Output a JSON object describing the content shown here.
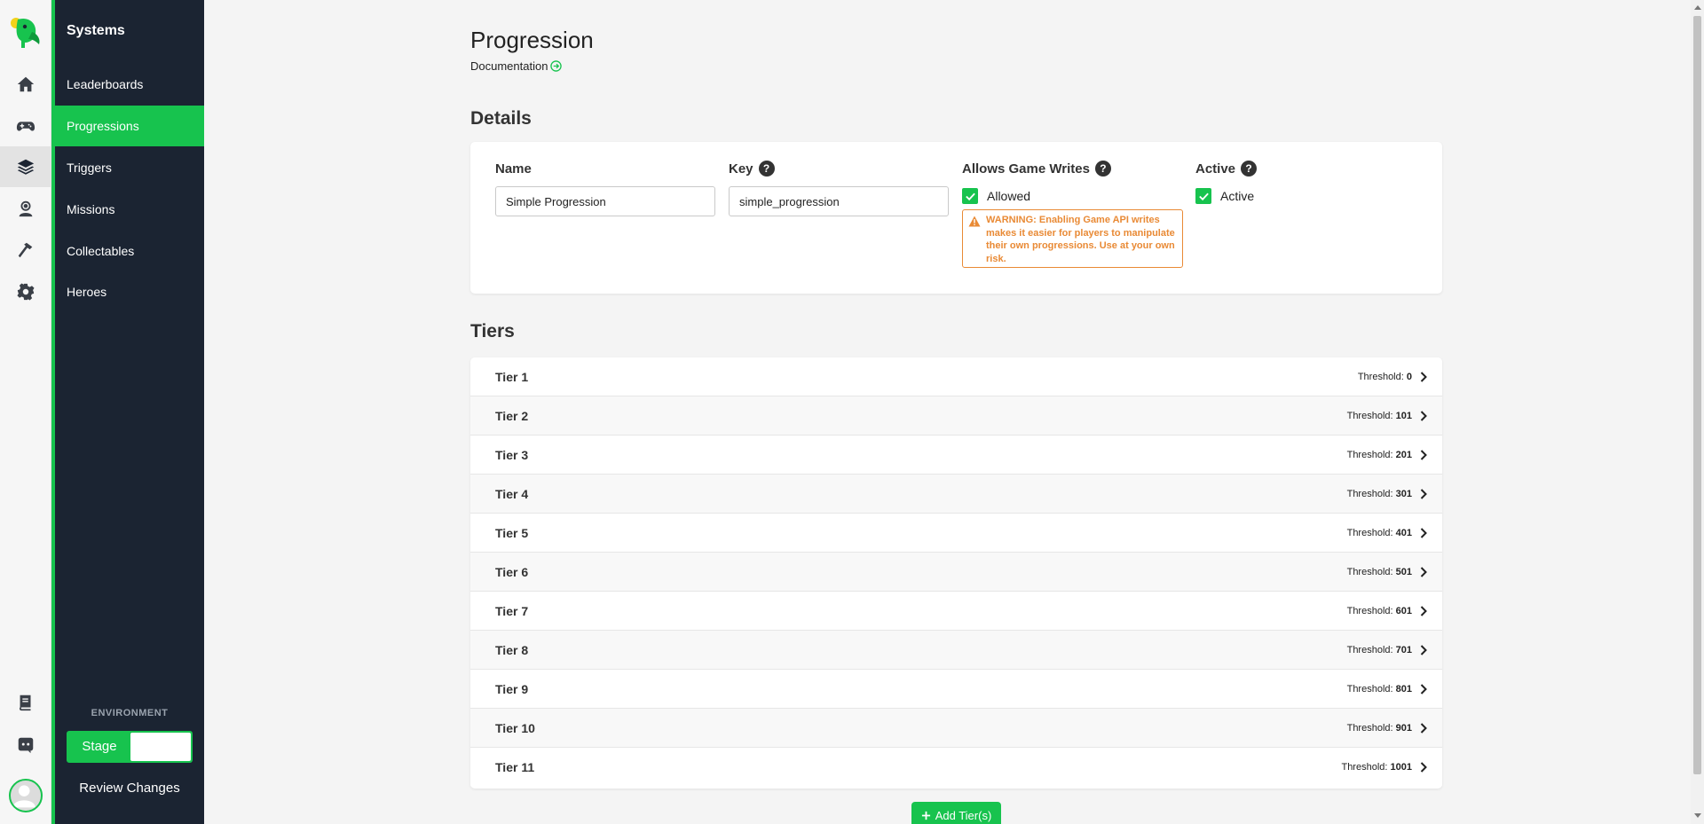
{
  "sidebar": {
    "title": "Systems",
    "items": [
      {
        "label": "Leaderboards"
      },
      {
        "label": "Progressions"
      },
      {
        "label": "Triggers"
      },
      {
        "label": "Missions"
      },
      {
        "label": "Collectables"
      },
      {
        "label": "Heroes"
      }
    ],
    "active_index": 1,
    "environment_label": "ENVIRONMENT",
    "environment_value": "Stage",
    "review_changes": "Review Changes"
  },
  "rail": {
    "icons": [
      "home-icon",
      "gamepad-icon",
      "layers-icon",
      "user-headset-icon",
      "hammer-icon",
      "gear-icon",
      "book-icon",
      "discord-icon"
    ],
    "active_icon": "layers-icon"
  },
  "page": {
    "title": "Progression",
    "doc_link": "Documentation"
  },
  "details": {
    "section_title": "Details",
    "name_label": "Name",
    "name_value": "Simple Progression",
    "key_label": "Key",
    "key_value": "simple_progression",
    "writes_label": "Allows Game Writes",
    "writes_checkbox": "Allowed",
    "warning": "WARNING: Enabling Game API writes makes it easier for players to manipulate their own progressions. Use at your own risk.",
    "active_label": "Active",
    "active_checkbox": "Active"
  },
  "tiers": {
    "section_title": "Tiers",
    "threshold_label": "Threshold:",
    "rows": [
      {
        "name": "Tier 1",
        "threshold": "0"
      },
      {
        "name": "Tier 2",
        "threshold": "101"
      },
      {
        "name": "Tier 3",
        "threshold": "201"
      },
      {
        "name": "Tier 4",
        "threshold": "301"
      },
      {
        "name": "Tier 5",
        "threshold": "401"
      },
      {
        "name": "Tier 6",
        "threshold": "501"
      },
      {
        "name": "Tier 7",
        "threshold": "601"
      },
      {
        "name": "Tier 8",
        "threshold": "701"
      },
      {
        "name": "Tier 9",
        "threshold": "801"
      },
      {
        "name": "Tier 10",
        "threshold": "901"
      },
      {
        "name": "Tier 11",
        "threshold": "1001"
      }
    ],
    "add_button": "Add Tier(s)"
  },
  "colors": {
    "accent": "#17c34e",
    "sidebar_bg": "#1b2432",
    "warning": "#e98a35"
  }
}
